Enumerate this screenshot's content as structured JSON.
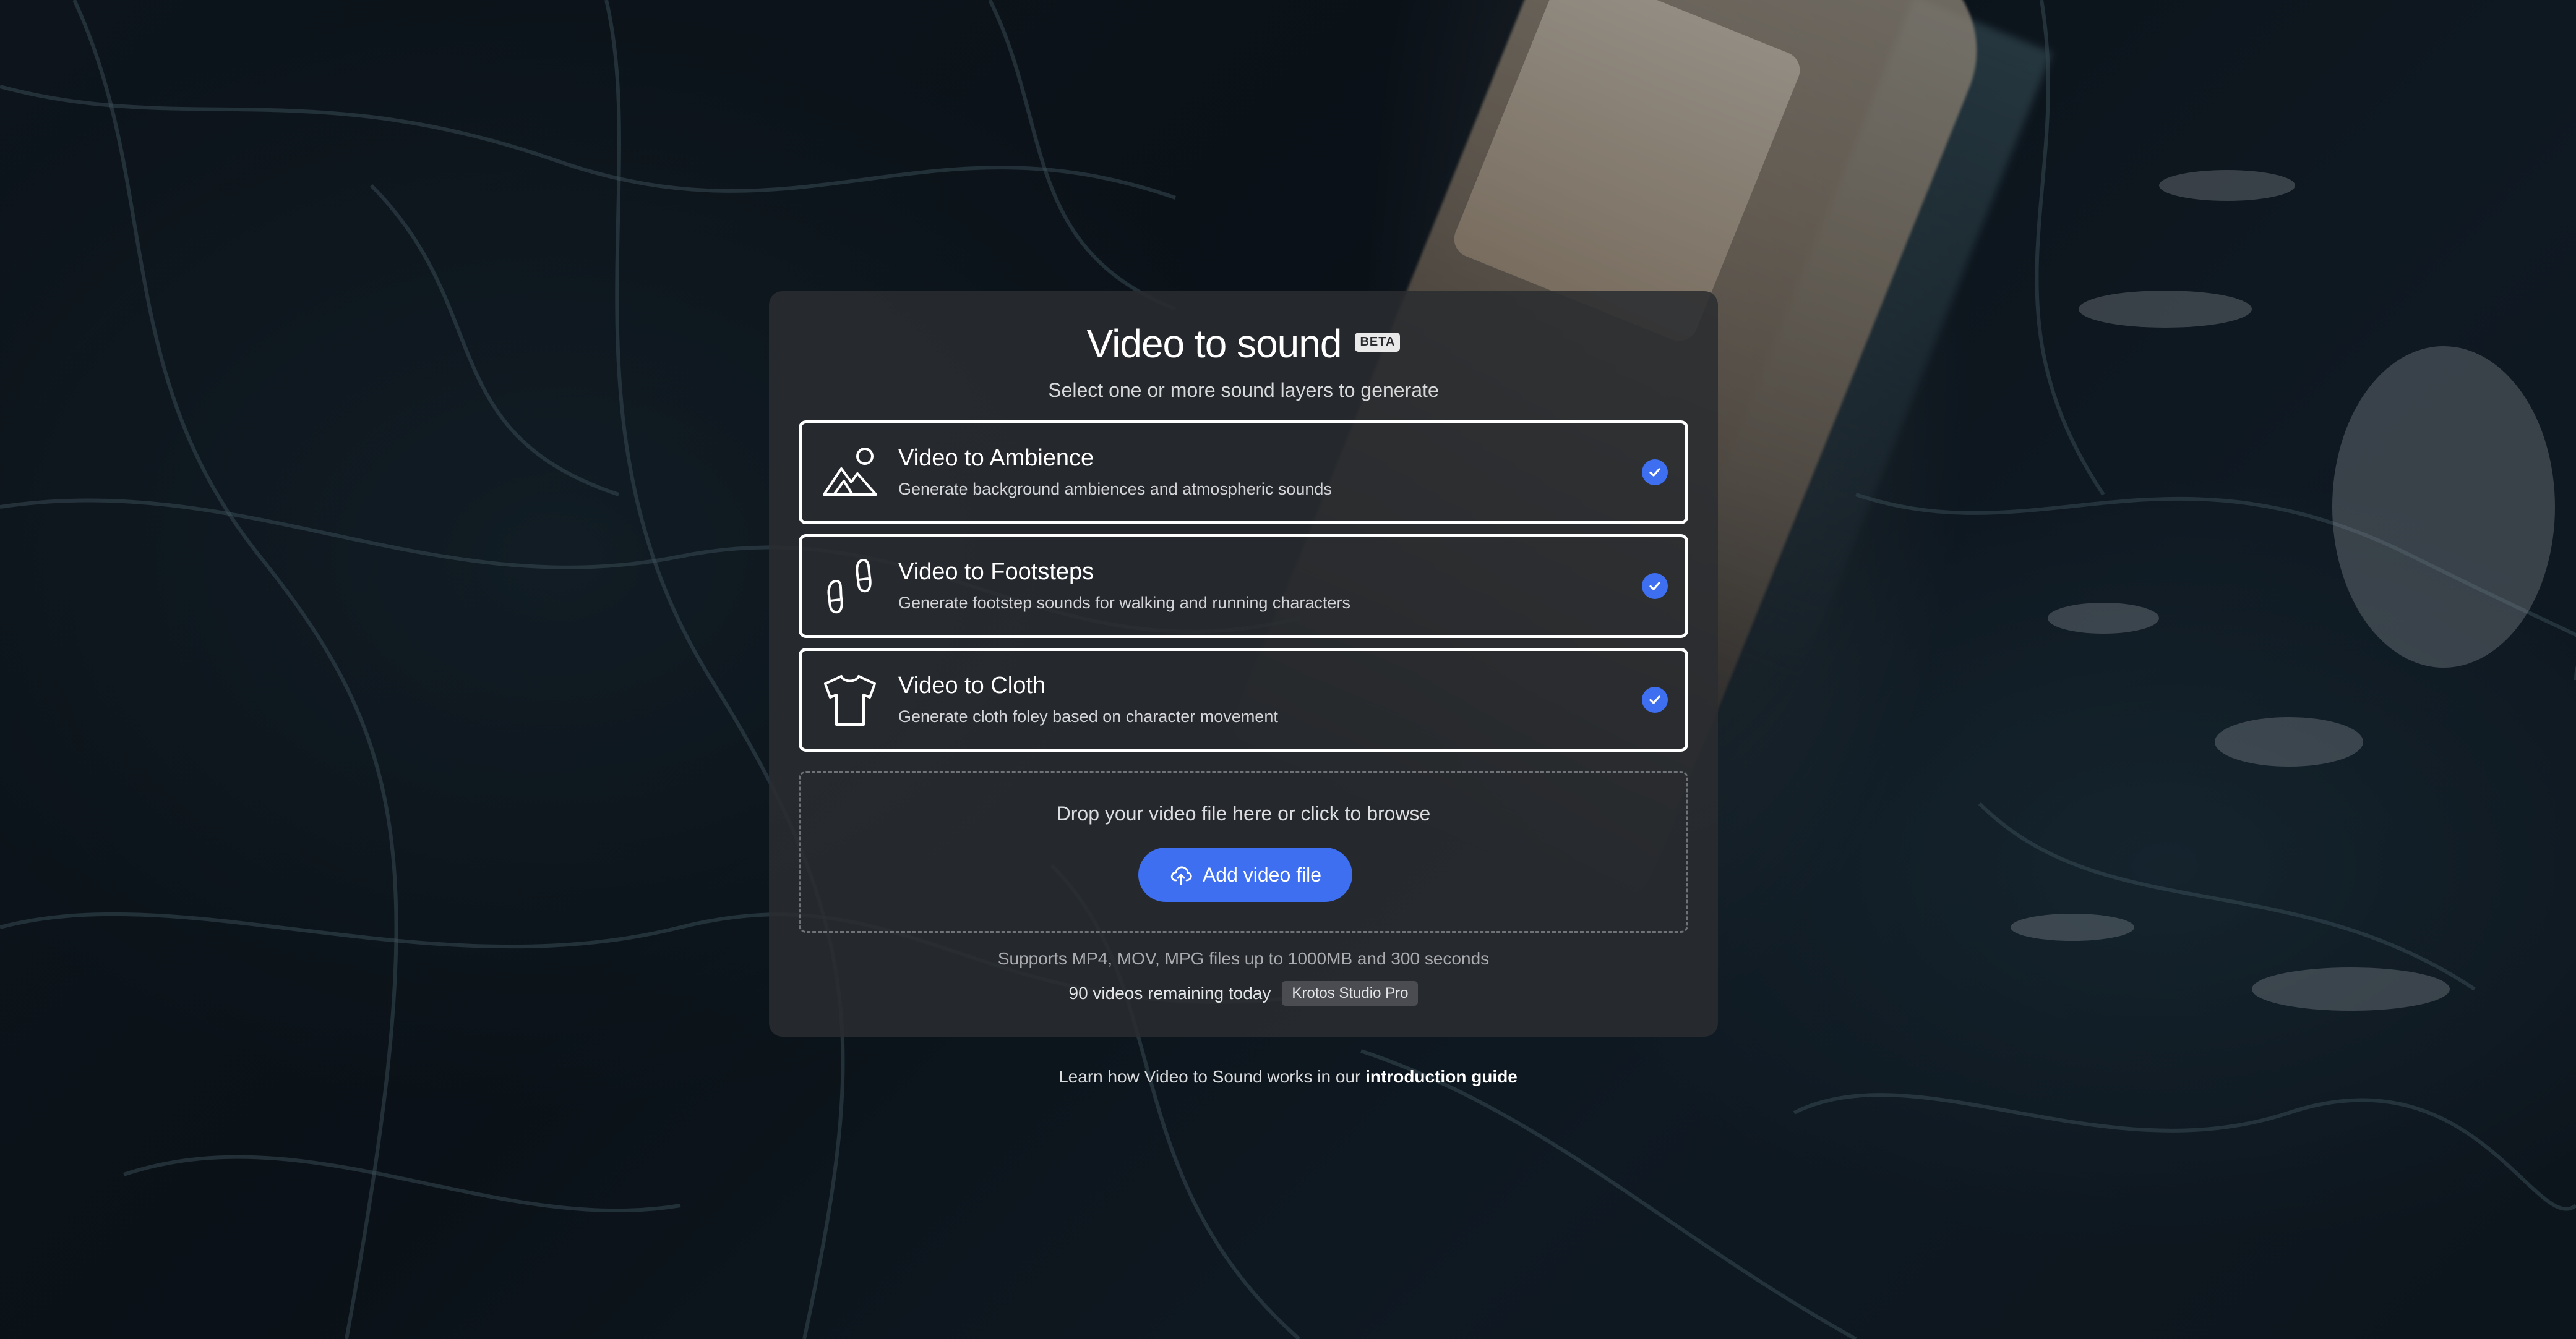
{
  "header": {
    "title": "Video to sound",
    "badge": "BETA",
    "subtitle": "Select one or more sound layers to generate"
  },
  "options": [
    {
      "title": "Video to Ambience",
      "description": "Generate background ambiences and atmospheric sounds",
      "icon": "mountain-sun-icon",
      "selected": true
    },
    {
      "title": "Video to Footsteps",
      "description": "Generate footstep sounds for walking and running characters",
      "icon": "footprints-icon",
      "selected": true
    },
    {
      "title": "Video to Cloth",
      "description": "Generate cloth foley based on character movement",
      "icon": "tshirt-icon",
      "selected": true
    }
  ],
  "dropzone": {
    "text": "Drop your video file here or click to browse",
    "button_label": "Add video file",
    "button_icon": "cloud-upload-icon"
  },
  "info": {
    "supports": "Supports MP4, MOV, MPG files up to 1000MB and 300 seconds",
    "remaining": "90 videos remaining today",
    "plan": "Krotos Studio Pro"
  },
  "footer": {
    "learn_prefix": "Learn how Video to Sound works in our ",
    "learn_link": "introduction guide"
  },
  "colors": {
    "accent": "#3d6ff0",
    "panel": "#2a2c30",
    "text": "#ffffff"
  }
}
